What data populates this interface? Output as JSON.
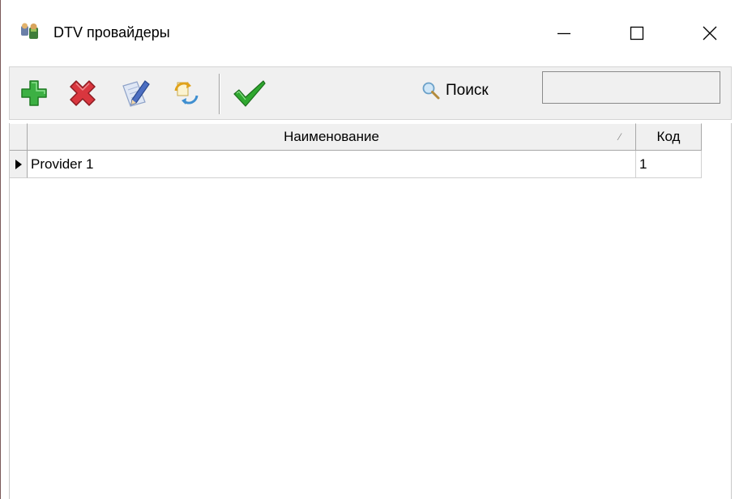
{
  "window": {
    "title": "DTV провайдеры",
    "minimize_icon": "minimize-icon",
    "maximize_icon": "maximize-icon",
    "close_icon": "close-icon"
  },
  "toolbar": {
    "buttons": [
      {
        "name": "add",
        "icon": "plus-icon"
      },
      {
        "name": "delete",
        "icon": "delete-x-icon"
      },
      {
        "name": "edit",
        "icon": "edit-pencil-icon"
      },
      {
        "name": "refresh",
        "icon": "refresh-icon"
      },
      {
        "name": "select",
        "icon": "checkmark-icon"
      }
    ],
    "search": {
      "label": "Поиск",
      "icon": "magnifier-icon",
      "value": "",
      "placeholder": ""
    }
  },
  "grid": {
    "columns": [
      "Наименование",
      "Код"
    ],
    "sort_indicator": "⁄",
    "rows": [
      {
        "name": "Provider 1",
        "code": "1",
        "current": true
      }
    ]
  },
  "colors": {
    "add_green": "#3cb043",
    "delete_red": "#d9363e",
    "check_green": "#2fa82f",
    "toolbar_bg": "#f0f0f0"
  }
}
